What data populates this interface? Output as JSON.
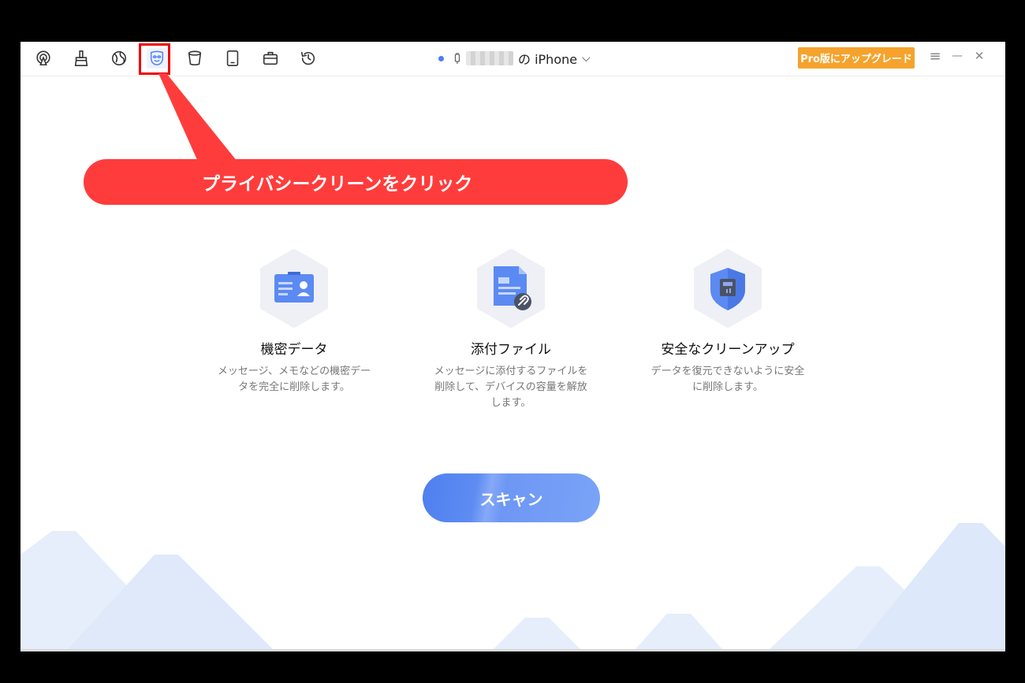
{
  "toolbar": {
    "tools": [
      {
        "name": "airplay-icon"
      },
      {
        "name": "broom-icon"
      },
      {
        "name": "globe-icon"
      },
      {
        "name": "mask-icon"
      },
      {
        "name": "trash-bin-icon"
      },
      {
        "name": "tablet-icon"
      },
      {
        "name": "briefcase-icon"
      },
      {
        "name": "history-icon"
      }
    ],
    "device_suffix": "の iPhone",
    "device_chevron": "⌵",
    "pro_label": "Pro版にアップグレード",
    "menu_glyph": "≡",
    "minimize_glyph": "—",
    "close_glyph": "✕"
  },
  "callout": {
    "text": "プライバシークリーンをクリック"
  },
  "features": [
    {
      "title": "機密データ",
      "desc": "メッセージ、メモなどの機密データを完全に削除します。"
    },
    {
      "title": "添付ファイル",
      "desc": "メッセージに添付するファイルを削除して、デバイスの容量を解放します。"
    },
    {
      "title": "安全なクリーンアップ",
      "desc": "データを復元できないように安全に削除します。"
    }
  ],
  "scan_label": "スキャン",
  "colors": {
    "accent": "#4e7ff0",
    "pro": "#f5a32d",
    "callout": "#ff3c3c"
  }
}
